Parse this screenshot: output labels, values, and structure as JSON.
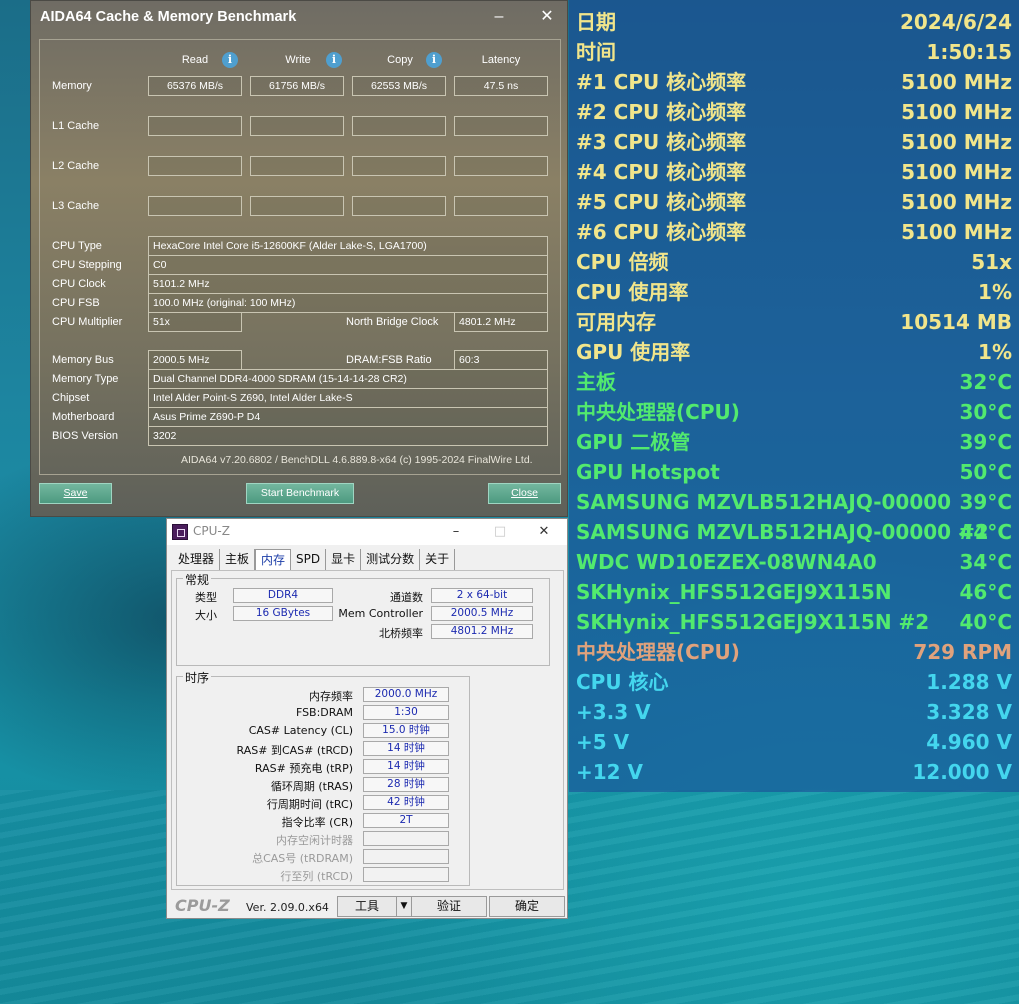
{
  "aida": {
    "title": "AIDA64 Cache & Memory Benchmark",
    "headers": {
      "read": "Read",
      "write": "Write",
      "copy": "Copy",
      "latency": "Latency"
    },
    "bench_rows": [
      {
        "label": "Memory",
        "read": "65376 MB/s",
        "write": "61756 MB/s",
        "copy": "62553 MB/s",
        "latency": "47.5 ns"
      },
      {
        "label": "L1 Cache",
        "read": "",
        "write": "",
        "copy": "",
        "latency": ""
      },
      {
        "label": "L2 Cache",
        "read": "",
        "write": "",
        "copy": "",
        "latency": ""
      },
      {
        "label": "L3 Cache",
        "read": "",
        "write": "",
        "copy": "",
        "latency": ""
      }
    ],
    "info": {
      "cpu_type_label": "CPU Type",
      "cpu_type": "HexaCore Intel Core i5-12600KF  (Alder Lake-S, LGA1700)",
      "cpu_stepping_label": "CPU Stepping",
      "cpu_stepping": "C0",
      "cpu_clock_label": "CPU Clock",
      "cpu_clock": "5101.2 MHz",
      "cpu_fsb_label": "CPU FSB",
      "cpu_fsb": "100.0 MHz  (original: 100 MHz)",
      "cpu_multiplier_label": "CPU Multiplier",
      "cpu_multiplier": "51x",
      "north_bridge_label": "North Bridge Clock",
      "north_bridge": "4801.2 MHz",
      "memory_bus_label": "Memory Bus",
      "memory_bus": "2000.5 MHz",
      "dram_fsb_label": "DRAM:FSB Ratio",
      "dram_fsb": "60:3",
      "memory_type_label": "Memory Type",
      "memory_type": "Dual Channel DDR4-4000 SDRAM  (15-14-14-28 CR2)",
      "chipset_label": "Chipset",
      "chipset": "Intel Alder Point-S Z690, Intel Alder Lake-S",
      "motherboard_label": "Motherboard",
      "motherboard": "Asus Prime Z690-P D4",
      "bios_label": "BIOS Version",
      "bios": "3202"
    },
    "footer": "AIDA64 v7.20.6802 / BenchDLL 4.6.889.8-x64  (c) 1995-2024 FinalWire Ltd.",
    "buttons": {
      "save": "Save",
      "start": "Start Benchmark",
      "close": "Close"
    }
  },
  "cpuz": {
    "title": "CPU-Z",
    "tabs": [
      "处理器",
      "主板",
      "内存",
      "SPD",
      "显卡",
      "测试分数",
      "关于"
    ],
    "general": {
      "title": "常规",
      "type_label": "类型",
      "type": "DDR4",
      "size_label": "大小",
      "size": "16 GBytes",
      "channels_label": "通道数",
      "channels": "2 x 64-bit",
      "mem_ctrl_label": "Mem Controller",
      "mem_ctrl": "2000.5 MHz",
      "nb_label": "北桥频率",
      "nb": "4801.2 MHz"
    },
    "timings": {
      "title": "时序",
      "rows": [
        {
          "label": "内存频率",
          "value": "2000.0 MHz",
          "dim": false
        },
        {
          "label": "FSB:DRAM",
          "value": "1:30",
          "dim": false
        },
        {
          "label": "CAS# Latency (CL)",
          "value": "15.0 时钟",
          "dim": false
        },
        {
          "label": "RAS# 到CAS# (tRCD)",
          "value": "14 时钟",
          "dim": false
        },
        {
          "label": "RAS# 预充电 (tRP)",
          "value": "14 时钟",
          "dim": false
        },
        {
          "label": "循环周期 (tRAS)",
          "value": "28 时钟",
          "dim": false
        },
        {
          "label": "行周期时间 (tRC)",
          "value": "42 时钟",
          "dim": false
        },
        {
          "label": "指令比率 (CR)",
          "value": "2T",
          "dim": false
        },
        {
          "label": "内存空闲计时器",
          "value": "",
          "dim": true
        },
        {
          "label": "总CAS号 (tRDRAM)",
          "value": "",
          "dim": true
        },
        {
          "label": "行至列 (tRCD)",
          "value": "",
          "dim": true
        }
      ]
    },
    "logo": "CPU-Z",
    "version": "Ver. 2.09.0.x64",
    "tools_label": "工具",
    "validate_label": "验证",
    "ok_label": "确定"
  },
  "sensor": {
    "rows": [
      {
        "label": "日期",
        "value": "2024/6/24",
        "color": "#f1e58b"
      },
      {
        "label": "时间",
        "value": "1:50:15",
        "color": "#f1e58b"
      },
      {
        "label": "#1 CPU 核心频率",
        "value": "5100 MHz",
        "color": "#f1e58b"
      },
      {
        "label": "#2 CPU 核心频率",
        "value": "5100 MHz",
        "color": "#f1e58b"
      },
      {
        "label": "#3 CPU 核心频率",
        "value": "5100 MHz",
        "color": "#f1e58b"
      },
      {
        "label": "#4 CPU 核心频率",
        "value": "5100 MHz",
        "color": "#f1e58b"
      },
      {
        "label": "#5 CPU 核心频率",
        "value": "5100 MHz",
        "color": "#f1e58b"
      },
      {
        "label": "#6 CPU 核心频率",
        "value": "5100 MHz",
        "color": "#f1e58b"
      },
      {
        "label": "CPU 倍频",
        "value": "51x",
        "color": "#f1e58b"
      },
      {
        "label": "CPU 使用率",
        "value": "1%",
        "color": "#f1e58b"
      },
      {
        "label": "可用内存",
        "value": "10514 MB",
        "color": "#f1e58b"
      },
      {
        "label": "GPU 使用率",
        "value": "1%",
        "color": "#f1e58b"
      },
      {
        "label": "主板",
        "value": "32°C",
        "color": "#52ea6e"
      },
      {
        "label": "中央处理器(CPU)",
        "value": "30°C",
        "color": "#52ea6e"
      },
      {
        "label": "GPU 二极管",
        "value": "39°C",
        "color": "#52ea6e"
      },
      {
        "label": "GPU Hotspot",
        "value": "50°C",
        "color": "#52ea6e"
      },
      {
        "label": "SAMSUNG MZVLB512HAJQ-00000",
        "value": "39°C",
        "color": "#52ea6e"
      },
      {
        "label": "SAMSUNG MZVLB512HAJQ-00000 #2",
        "value": "44°C",
        "color": "#52ea6e"
      },
      {
        "label": "WDC WD10EZEX-08WN4A0",
        "value": "34°C",
        "color": "#52ea6e"
      },
      {
        "label": "SKHynix_HFS512GEJ9X115N",
        "value": "46°C",
        "color": "#52ea6e"
      },
      {
        "label": "SKHynix_HFS512GEJ9X115N #2",
        "value": "40°C",
        "color": "#52ea6e"
      },
      {
        "label": "中央处理器(CPU)",
        "value": "729 RPM",
        "color": "#e0a27c"
      },
      {
        "label": "CPU 核心",
        "value": "1.288 V",
        "color": "#44d6ee"
      },
      {
        "label": "+3.3 V",
        "value": "3.328 V",
        "color": "#44d6ee"
      },
      {
        "label": "+5 V",
        "value": "4.960 V",
        "color": "#44d6ee"
      },
      {
        "label": "+12 V",
        "value": "12.000 V",
        "color": "#44d6ee"
      }
    ]
  }
}
